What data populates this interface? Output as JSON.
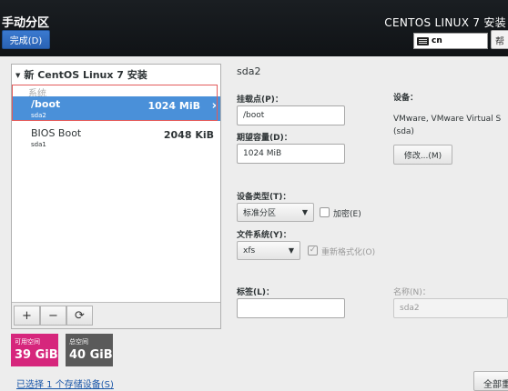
{
  "header": {
    "title": "手动分区",
    "done_label": "完成(D)",
    "product": "CENTOS LINUX 7 安装",
    "keyboard_layout": "cn",
    "help_label": "帮"
  },
  "tree": {
    "root_label": "新 CentOS Linux 7 安装",
    "group_label": "系统",
    "items": [
      {
        "mount": "/boot",
        "device": "sda2",
        "size": "1024 MiB",
        "selected": true
      },
      {
        "mount": "BIOS Boot",
        "device": "sda1",
        "size": "2048 KiB",
        "selected": false
      }
    ],
    "toolbar": {
      "add": "+",
      "remove": "−",
      "refresh": "⟳"
    }
  },
  "space": {
    "available_label": "可用空间",
    "available_value": "39 GiB",
    "available_color": "#d6267c",
    "total_label": "总空间",
    "total_value": "40 GiB",
    "total_color": "#5a5a5a"
  },
  "storage_link": "已选择 1 个存储设备(S)",
  "reset_label": "全部重",
  "details": {
    "title": "sda2",
    "mount_label": "挂载点(P)：",
    "mount_value": "/boot",
    "capacity_label": "期望容量(D)：",
    "capacity_value": "1024 MiB",
    "device_label": "设备：",
    "device_line1": "VMware, VMware Virtual S",
    "device_line2": "(sda)",
    "modify_label": "修改...(M)",
    "type_label": "设备类型(T)：",
    "type_value": "标准分区",
    "encrypt_label": "加密(E)",
    "fs_label": "文件系统(Y)：",
    "fs_value": "xfs",
    "reformat_label": "重新格式化(O)",
    "tag_label": "标签(L)：",
    "tag_value": "",
    "name_label": "名称(N)：",
    "name_value": "sda2"
  }
}
